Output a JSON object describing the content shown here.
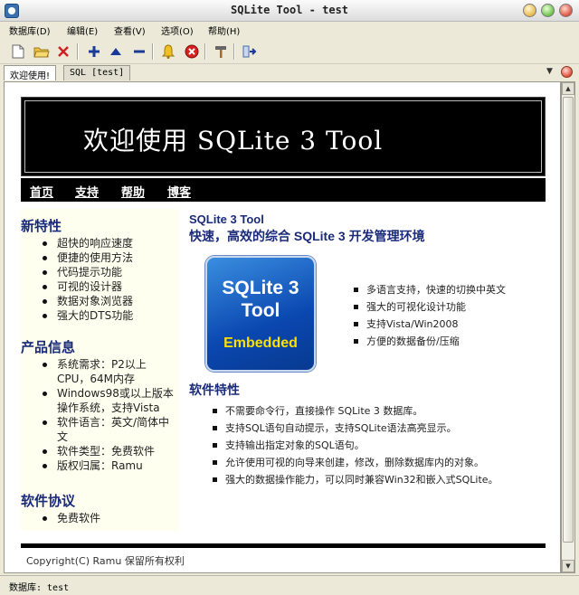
{
  "window": {
    "title": "SQLite Tool - test"
  },
  "menu": [
    "数据库(D)",
    "编辑(E)",
    "查看(V)",
    "选项(O)",
    "帮助(H)"
  ],
  "toolbar": {
    "icons": [
      "new-file-icon",
      "open-folder-icon",
      "delete-icon",
      "add-icon",
      "move-up-icon",
      "remove-icon",
      "bell-icon",
      "stop-icon",
      "hammer-icon",
      "export-icon"
    ]
  },
  "tabs": [
    {
      "label": "欢迎使用!",
      "active": true
    },
    {
      "label": "SQL [test]",
      "active": false
    }
  ],
  "page": {
    "banner_title": "欢迎使用 SQLite 3 Tool",
    "nav": [
      "首页",
      "支持",
      "帮助",
      "博客"
    ],
    "new_features": {
      "heading": "新特性",
      "items": [
        "超快的响应速度",
        "便捷的使用方法",
        "代码提示功能",
        "可视的设计器",
        "数据对象浏览器",
        "强大的DTS功能"
      ]
    },
    "product_info": {
      "heading": "产品信息",
      "items": [
        "系统需求：P2以上CPU，64M内存",
        "Windows98或以上版本操作系统，支持Vista",
        "软件语言：英文/简体中文",
        "软件类型：免费软件",
        "版权归属：Ramu"
      ]
    },
    "license": {
      "heading": "软件协议",
      "items": [
        "免费软件"
      ]
    },
    "product_title": "SQLite 3 Tool",
    "product_subtitle": "快速，高效的综合  SQLite 3 开发管理环境",
    "logo": {
      "line1": "SQLite 3",
      "line2": "Tool",
      "line3": "Embedded"
    },
    "feature_bullets": [
      "多语言支持，快速的切换中英文",
      "强大的可视化设计功能",
      "支持Vista/Win2008",
      "方便的数据备份/压缩"
    ],
    "specs": {
      "heading": "软件特性",
      "items": [
        "不需要命令行，直接操作  SQLite 3 数据库。",
        "支持SQL语句自动提示，支持SQLite语法高亮显示。",
        "支持输出指定对象的SQL语句。",
        "允许使用可视的向导来创建，修改，删除数据库内的对象。",
        "强大的数据操作能力，可以同时兼容Win32和嵌入式SQLite。"
      ]
    },
    "footer": "Copyright(C) Ramu 保留所有权利"
  },
  "status": {
    "text": "数据库: test"
  }
}
